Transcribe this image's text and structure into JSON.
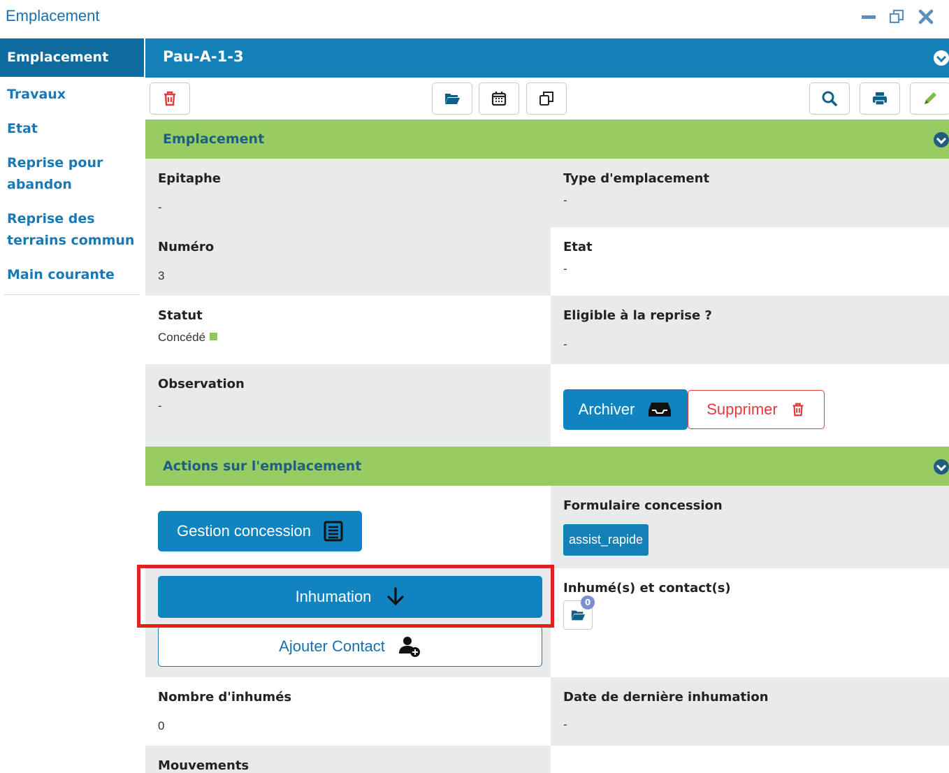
{
  "window": {
    "title": "Emplacement"
  },
  "sidebar": {
    "items": [
      {
        "label": "Emplacement",
        "active": true
      },
      {
        "label": "Travaux"
      },
      {
        "label": "Etat"
      },
      {
        "label": "Reprise pour abandon"
      },
      {
        "label": "Reprise des terrains commun"
      },
      {
        "label": "Main courante"
      }
    ]
  },
  "header": {
    "title": "Pau-A-1-3"
  },
  "toolbar": {
    "icons": [
      "trash-icon",
      "folder-open-icon",
      "calendar-icon",
      "copy-icon",
      "search-icon",
      "print-icon",
      "pencil-icon"
    ]
  },
  "section_emplacement": {
    "title": "Emplacement",
    "fields": {
      "epitaphe": {
        "label": "Epitaphe",
        "value": "-"
      },
      "type": {
        "label": "Type d'emplacement",
        "value": "-"
      },
      "numero": {
        "label": "Numéro",
        "value": "3"
      },
      "etat": {
        "label": "Etat",
        "value": "-"
      },
      "statut": {
        "label": "Statut",
        "value": "Concédé"
      },
      "eligible": {
        "label": "Eligible à la reprise ?",
        "value": "-"
      },
      "observation": {
        "label": "Observation",
        "value": "-"
      }
    },
    "archive_label": "Archiver",
    "delete_label": "Supprimer"
  },
  "section_actions": {
    "title": "Actions sur l'emplacement",
    "gestion_label": "Gestion concession",
    "formulaire_label": "Formulaire concession",
    "formulaire_tag": "assist_rapide",
    "inhumation_label": "Inhumation",
    "ajouter_contact_label": "Ajouter Contact",
    "inhumes_label": "Inhumé(s) et contact(s)",
    "inhumes_count": "0",
    "nombre_inhumes": {
      "label": "Nombre d'inhumés",
      "value": "0"
    },
    "date_derniere": {
      "label": "Date de dernière inhumation",
      "value": "-"
    },
    "mouvements_label": "Mouvements"
  },
  "colors": {
    "header_blue": "#1480b8",
    "section_green": "#96cc62",
    "primary_button": "#0f84c1",
    "danger": "#e23b3b",
    "highlight": "#e12020"
  }
}
